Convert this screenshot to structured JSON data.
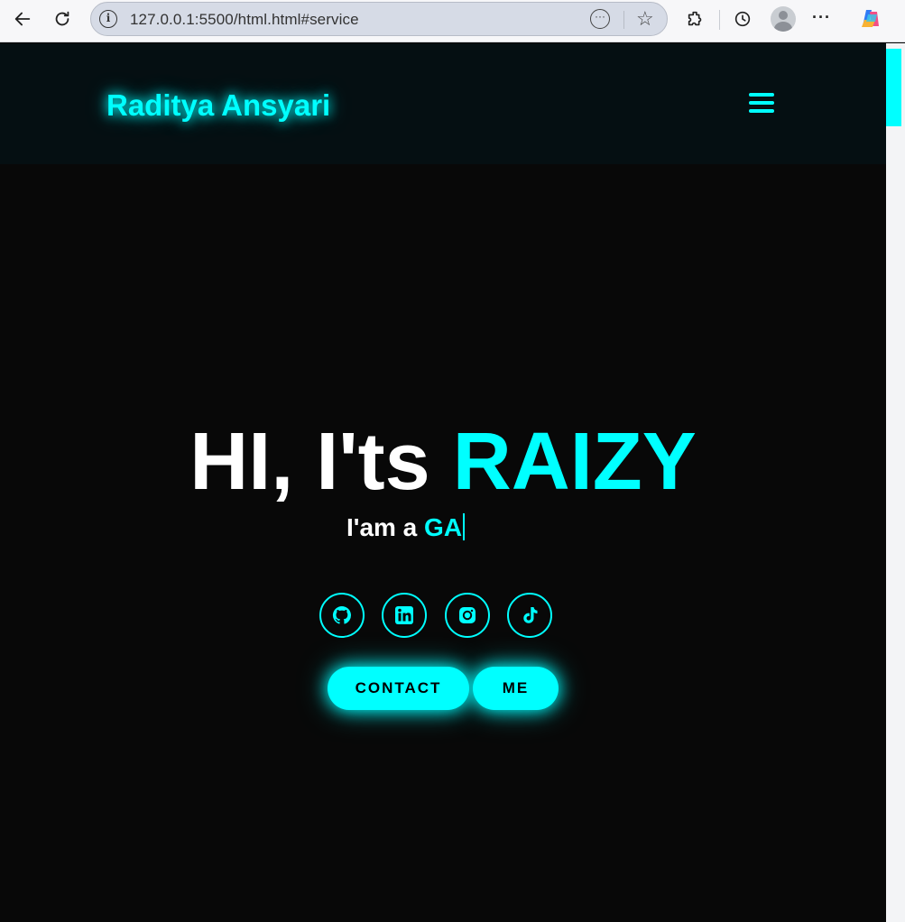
{
  "browser": {
    "url": "127.0.0.1:5500/html.html#service"
  },
  "header": {
    "logo": "Raditya Ansyari"
  },
  "hero": {
    "greeting": "HI, I'ts",
    "name": "RAIZY",
    "subtitle_prefix": "I'am a",
    "typed_text": "GA"
  },
  "socials": [
    {
      "icon": "github-icon"
    },
    {
      "icon": "linkedin-icon"
    },
    {
      "icon": "instagram-icon"
    },
    {
      "icon": "tiktok-icon"
    }
  ],
  "buttons": {
    "contact": "CONTACT",
    "me": "ME"
  },
  "colors": {
    "accent": "#00ffff",
    "background": "#080808",
    "header_bg": "#050f12",
    "text": "#ffffff"
  }
}
